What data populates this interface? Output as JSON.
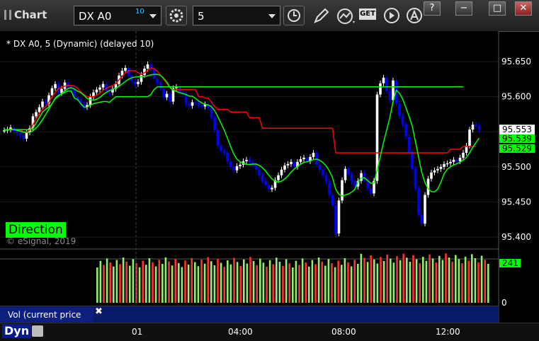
{
  "app": {
    "title": "Chart",
    "symbol": "DX A0",
    "symbol_badge": "10",
    "interval": "5",
    "toolbar_icons": [
      "gear-icon",
      "clock-icon",
      "pencil-icon",
      "studies-icon",
      "get-icon",
      "play-icon",
      "autoscale-icon"
    ],
    "window_buttons": [
      "?",
      "−",
      "□",
      "✕"
    ]
  },
  "legend_text": "* DX A0, 5 (Dynamic) (delayed 10)",
  "direction_label": "Direction",
  "copyright": "© eSignal, 2019",
  "volume_label": "Vol (current price bar)",
  "volume_close": "✖",
  "dyn_label": "Dyn",
  "colors": {
    "up": "#ffffff",
    "down": "#0000ff",
    "red": "#ff0000",
    "green": "#00ff00",
    "vol_up": "#90ee70",
    "vol_down": "#ff3030"
  },
  "chart_data": [
    {
      "type": "candlestick",
      "y_ticks": [
        "95.650",
        "95.600",
        "95.550",
        "95.500",
        "95.450",
        "95.400"
      ],
      "ylim": [
        95.395,
        95.675
      ],
      "x_ticks": [
        "01",
        "04:00",
        "08:00",
        "12:00"
      ],
      "last_price": "95.553",
      "green_labels": [
        "95.539",
        "95.529"
      ],
      "closes": [
        95.552,
        95.553,
        95.556,
        95.551,
        95.548,
        95.545,
        95.54,
        95.549,
        95.555,
        95.572,
        95.578,
        95.585,
        95.593,
        95.59,
        95.602,
        95.612,
        95.618,
        95.605,
        95.611,
        95.62,
        95.613,
        95.61,
        95.6,
        95.596,
        95.59,
        95.585,
        95.588,
        95.6,
        95.606,
        95.61,
        95.613,
        95.618,
        95.608,
        95.606,
        95.611,
        95.618,
        95.63,
        95.637,
        95.641,
        95.63,
        95.622,
        95.618,
        95.621,
        95.631,
        95.64,
        95.646,
        95.64,
        95.626,
        95.619,
        95.612,
        95.599,
        95.604,
        95.593,
        95.612,
        95.614,
        95.606,
        95.603,
        95.59,
        95.587,
        95.592,
        95.591,
        95.588,
        95.586,
        95.589,
        95.584,
        95.571,
        95.552,
        95.53,
        95.523,
        95.52,
        95.508,
        95.5,
        95.495,
        95.501,
        95.503,
        95.508,
        95.51,
        95.507,
        95.503,
        95.496,
        95.488,
        95.48,
        95.474,
        95.468,
        95.47,
        95.481,
        95.488,
        95.496,
        95.502,
        95.504,
        95.507,
        95.5,
        95.507,
        95.511,
        95.513,
        95.508,
        95.514,
        95.52,
        95.503,
        95.496,
        95.488,
        95.479,
        95.46,
        95.445,
        95.405,
        95.452,
        95.481,
        95.497,
        95.489,
        95.479,
        95.472,
        95.48,
        95.491,
        95.482,
        95.47,
        95.462,
        95.48,
        95.603,
        95.619,
        95.627,
        95.608,
        95.595,
        95.623,
        95.59,
        95.572,
        95.561,
        95.543,
        95.521,
        95.497,
        95.47,
        95.432,
        95.419,
        95.46,
        95.483,
        95.492,
        95.495,
        95.497,
        95.5,
        95.504,
        95.505,
        95.507,
        95.51,
        95.508,
        95.513,
        95.52,
        95.53,
        95.553,
        95.56,
        95.558,
        95.553
      ],
      "red_line": [
        95.553,
        95.553,
        95.553,
        95.553,
        95.553,
        95.553,
        95.55,
        95.55,
        95.552,
        95.56,
        95.568,
        95.576,
        95.582,
        95.586,
        95.592,
        95.6,
        95.606,
        95.612,
        95.613,
        95.615,
        95.616,
        95.616,
        95.615,
        95.612,
        95.607,
        95.603,
        95.6,
        95.6,
        95.6,
        95.602,
        95.605,
        95.609,
        95.612,
        95.614,
        95.616,
        95.619,
        95.624,
        95.629,
        95.634,
        95.637,
        95.637,
        95.637,
        95.634,
        95.632,
        95.634,
        95.638,
        95.641,
        95.64,
        95.636,
        95.631,
        95.625,
        95.619,
        95.613,
        95.61,
        95.61,
        95.61,
        95.61,
        95.61,
        95.61,
        95.61,
        95.61,
        95.6,
        95.6,
        95.598,
        95.598,
        95.592,
        95.586,
        95.582,
        95.582,
        95.582,
        95.582,
        95.578,
        95.578,
        95.578,
        95.578,
        95.578,
        95.578,
        95.57,
        95.57,
        95.57,
        95.57,
        95.555,
        95.555,
        95.555,
        95.555,
        95.555,
        95.555,
        95.555,
        95.555,
        95.555,
        95.555,
        95.555,
        95.555,
        95.555,
        95.555,
        95.555,
        95.555,
        95.555,
        95.555,
        95.555,
        95.555,
        95.555,
        95.555,
        95.555,
        95.52,
        95.52,
        95.52,
        95.52,
        95.52,
        95.52,
        95.52,
        95.52,
        95.52,
        95.52,
        95.52,
        95.52,
        95.52,
        95.52,
        95.52,
        95.52,
        95.52,
        95.52,
        95.52,
        95.52,
        95.52,
        95.52,
        95.52,
        95.52,
        95.52,
        95.52,
        95.52,
        95.52,
        95.52,
        95.52,
        95.52,
        95.52,
        95.52,
        95.52,
        95.52,
        95.52,
        95.525,
        95.525,
        95.525,
        95.525,
        95.529,
        95.529,
        95.529,
        95.529,
        95.529
      ],
      "green_line": [
        95.553,
        95.553,
        95.553,
        95.553,
        95.553,
        95.553,
        95.553,
        95.553,
        95.553,
        95.555,
        95.562,
        95.57,
        95.578,
        95.582,
        95.585,
        95.59,
        95.598,
        95.602,
        95.604,
        95.606,
        95.608,
        95.608,
        95.598,
        95.596,
        95.59,
        95.585,
        95.585,
        95.588,
        95.59,
        95.591,
        95.592,
        95.593,
        95.593,
        95.592,
        95.596,
        95.6,
        95.6,
        95.6,
        95.6,
        95.6,
        95.6,
        95.6,
        95.6,
        95.6,
        95.6,
        95.6,
        95.603,
        95.61,
        95.614,
        95.614,
        95.614,
        95.614,
        95.614,
        95.614,
        95.614,
        95.614,
        95.614,
        95.614,
        95.614,
        95.614,
        95.614,
        95.614,
        95.614,
        95.614,
        95.614,
        95.614,
        95.614,
        95.614,
        95.614,
        95.614,
        95.614,
        95.614,
        95.614,
        95.614,
        95.614,
        95.614,
        95.614,
        95.614,
        95.614,
        95.614,
        95.614,
        95.614,
        95.614,
        95.614,
        95.614,
        95.614,
        95.614,
        95.614,
        95.614,
        95.614,
        95.614,
        95.614,
        95.614,
        95.614,
        95.614,
        95.614,
        95.614,
        95.614,
        95.614,
        95.614,
        95.614,
        95.614,
        95.614,
        95.614,
        95.614,
        95.614,
        95.614,
        95.614,
        95.614,
        95.614,
        95.614,
        95.614,
        95.614,
        95.614,
        95.614,
        95.614,
        95.614,
        95.614,
        95.614,
        95.614,
        95.614,
        95.614,
        95.614,
        95.614,
        95.614,
        95.614,
        95.614,
        95.614,
        95.614,
        95.614,
        95.614,
        95.614,
        95.614,
        95.614,
        95.614,
        95.614,
        95.614,
        95.614,
        95.614,
        95.614,
        95.614,
        95.614,
        95.614,
        95.614,
        95.614
      ]
    },
    {
      "type": "bar",
      "title": "Vol (current price bar)",
      "y_ticks": [
        "0"
      ],
      "last_value": "241",
      "volumes_start_index": 40
    }
  ]
}
